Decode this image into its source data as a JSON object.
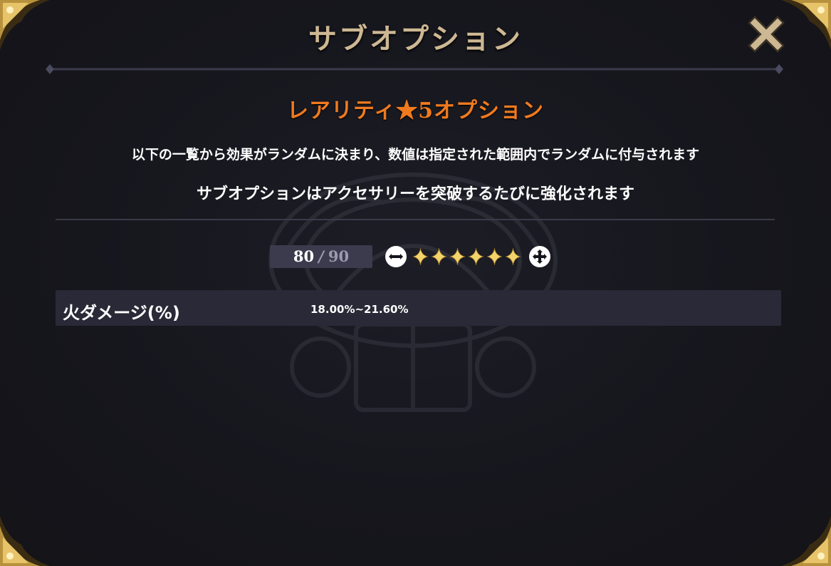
{
  "dialog": {
    "title": "サブオプション",
    "close_label": "close"
  },
  "rarity": {
    "heading": "レアリティ★5オプション"
  },
  "description": {
    "line1": "以下の一覧から効果がランダムに決まり、数値は指定された範囲内でランダムに付与されます",
    "line2": "サブオプションはアクセサリーを突破するたびに強化されます"
  },
  "level": {
    "current": "80",
    "separator": "/",
    "max": "90"
  },
  "stars": {
    "count": 6
  },
  "options": [
    {
      "name": "火ダメージ(%)",
      "range": "18.00%~21.60%"
    }
  ],
  "colors": {
    "title": "#cdb893",
    "rarity": "#f07a1e",
    "star": "#f3d36a",
    "row_bg": "#292937"
  }
}
